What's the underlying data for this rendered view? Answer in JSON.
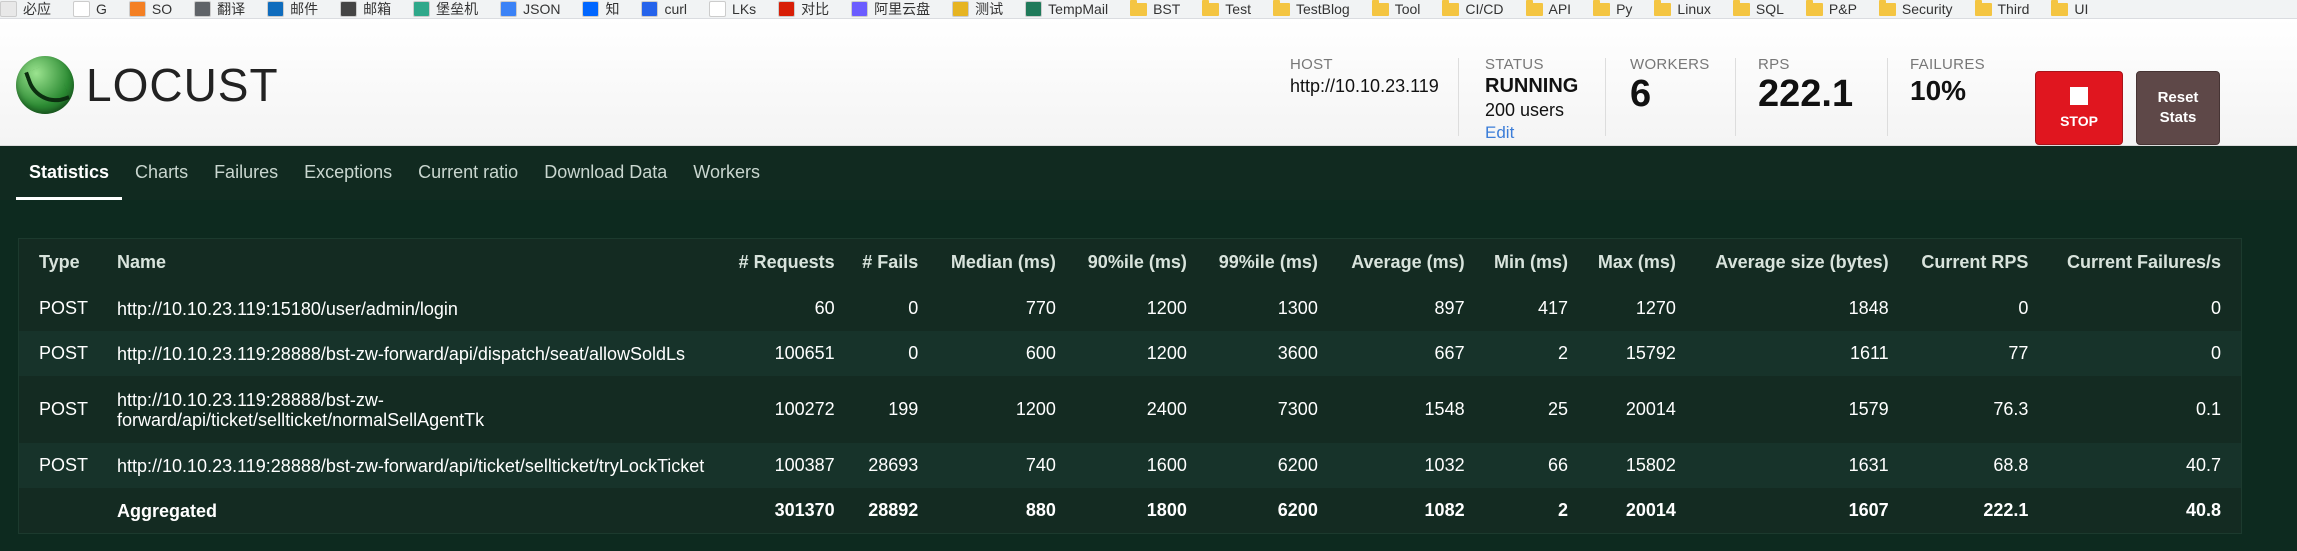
{
  "bookmarks": [
    {
      "label": "必应",
      "icon": "bing-icon",
      "color": "#e8e8e8"
    },
    {
      "label": "G",
      "icon": "page-icon",
      "color": "#ffffff"
    },
    {
      "label": "SO",
      "icon": "stackoverflow-icon",
      "color": "#f48024"
    },
    {
      "label": "翻译",
      "icon": "translate-icon",
      "color": "#5f6368"
    },
    {
      "label": "邮件",
      "icon": "outlook-icon",
      "color": "#0f6cbd"
    },
    {
      "label": "邮箱",
      "icon": "mail-icon",
      "color": "#444444"
    },
    {
      "label": "堡垒机",
      "icon": "bastion-icon",
      "color": "#2fa88a"
    },
    {
      "label": "JSON",
      "icon": "json-icon",
      "color": "#3b82f6"
    },
    {
      "label": "知",
      "icon": "zhihu-icon",
      "color": "#0066ff"
    },
    {
      "label": "curl",
      "icon": "curl-icon",
      "color": "#2563eb"
    },
    {
      "label": "LKs",
      "icon": "page-icon",
      "color": "#ffffff"
    },
    {
      "label": "对比",
      "icon": "diff-icon",
      "color": "#d81e06"
    },
    {
      "label": "阿里云盘",
      "icon": "aliyun-drive-icon",
      "color": "#6b5cff"
    },
    {
      "label": "测试",
      "icon": "test-icon",
      "color": "#e6b422"
    },
    {
      "label": "TempMail",
      "icon": "tempmail-icon",
      "color": "#1f7a5a"
    },
    {
      "label": "BST",
      "icon": "folder-icon",
      "color": "#f4c542"
    },
    {
      "label": "Test",
      "icon": "folder-icon",
      "color": "#f4c542"
    },
    {
      "label": "TestBlog",
      "icon": "folder-icon",
      "color": "#f4c542"
    },
    {
      "label": "Tool",
      "icon": "folder-icon",
      "color": "#f4c542"
    },
    {
      "label": "CI/CD",
      "icon": "folder-icon",
      "color": "#f4c542"
    },
    {
      "label": "API",
      "icon": "folder-icon",
      "color": "#f4c542"
    },
    {
      "label": "Py",
      "icon": "folder-icon",
      "color": "#f4c542"
    },
    {
      "label": "Linux",
      "icon": "folder-icon",
      "color": "#f4c542"
    },
    {
      "label": "SQL",
      "icon": "folder-icon",
      "color": "#f4c542"
    },
    {
      "label": "P&P",
      "icon": "folder-icon",
      "color": "#f4c542"
    },
    {
      "label": "Security",
      "icon": "folder-icon",
      "color": "#f4c542"
    },
    {
      "label": "Third",
      "icon": "folder-icon",
      "color": "#f4c542"
    },
    {
      "label": "UI",
      "icon": "folder-icon",
      "color": "#f4c542"
    }
  ],
  "header": {
    "logo_text": "LOCUST",
    "host": {
      "label": "HOST",
      "value": "http://10.10.23.119"
    },
    "status": {
      "label": "STATUS",
      "value": "RUNNING",
      "users": "200 users",
      "edit": "Edit"
    },
    "workers": {
      "label": "WORKERS",
      "value": "6"
    },
    "rps": {
      "label": "RPS",
      "value": "222.1"
    },
    "failures": {
      "label": "FAILURES",
      "value": "10%"
    },
    "stop_label": "STOP",
    "reset_label_line1": "Reset",
    "reset_label_line2": "Stats"
  },
  "tabs": [
    "Statistics",
    "Charts",
    "Failures",
    "Exceptions",
    "Current ratio",
    "Download Data",
    "Workers"
  ],
  "active_tab": "Statistics",
  "table": {
    "columns": [
      "Type",
      "Name",
      "# Requests",
      "# Fails",
      "Median (ms)",
      "90%ile (ms)",
      "99%ile (ms)",
      "Average (ms)",
      "Min (ms)",
      "Max (ms)",
      "Average size (bytes)",
      "Current RPS",
      "Current Failures/s"
    ],
    "rows": [
      [
        "POST",
        "http://10.10.23.119:15180/user/admin/login",
        "60",
        "0",
        "770",
        "1200",
        "1300",
        "897",
        "417",
        "1270",
        "1848",
        "0",
        "0"
      ],
      [
        "POST",
        "http://10.10.23.119:28888/bst-zw-forward/api/dispatch/seat/allowSoldLs",
        "100651",
        "0",
        "600",
        "1200",
        "3600",
        "667",
        "2",
        "15792",
        "1611",
        "77",
        "0"
      ],
      [
        "POST",
        "http://10.10.23.119:28888/bst-zw-forward/api/ticket/sellticket/normalSellAgentTk",
        "100272",
        "199",
        "1200",
        "2400",
        "7300",
        "1548",
        "25",
        "20014",
        "1579",
        "76.3",
        "0.1"
      ],
      [
        "POST",
        "http://10.10.23.119:28888/bst-zw-forward/api/ticket/sellticket/tryLockTicket",
        "100387",
        "28693",
        "740",
        "1600",
        "6200",
        "1032",
        "66",
        "15802",
        "1631",
        "68.8",
        "40.7"
      ]
    ],
    "aggregated": [
      "",
      "Aggregated",
      "301370",
      "28892",
      "880",
      "1800",
      "6200",
      "1082",
      "2",
      "20014",
      "1607",
      "222.1",
      "40.8"
    ]
  },
  "colors": {
    "nav_bg": "#112a20",
    "table_bg": "#142b22",
    "stop_button": "#e0161f",
    "reset_button": "#5e4848",
    "edit_link": "#3b7dd8"
  }
}
